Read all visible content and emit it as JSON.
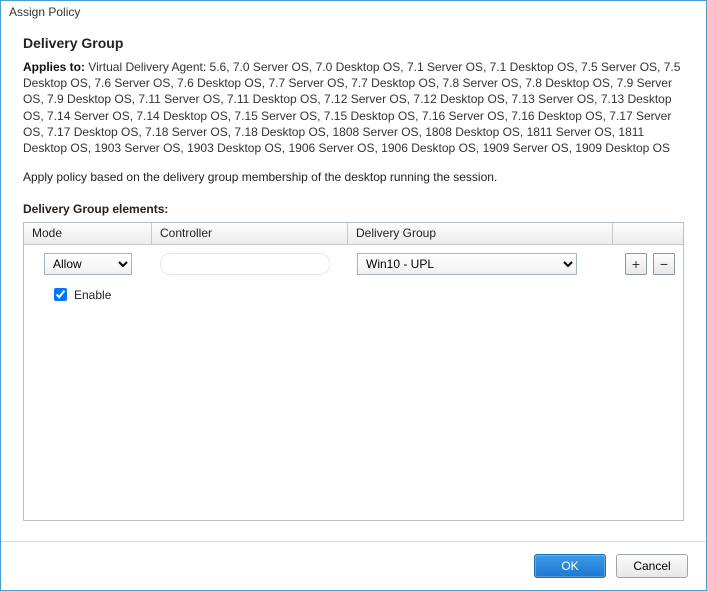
{
  "window_title": "Assign Policy",
  "heading": "Delivery Group",
  "applies_label": "Applies to:",
  "applies_text": "Virtual Delivery Agent: 5.6, 7.0 Server OS, 7.0 Desktop OS, 7.1 Server OS, 7.1 Desktop OS, 7.5 Server OS, 7.5 Desktop OS, 7.6 Server OS, 7.6 Desktop OS, 7.7 Server OS, 7.7 Desktop OS, 7.8 Server OS, 7.8 Desktop OS, 7.9 Server OS, 7.9 Desktop OS, 7.11 Server OS, 7.11 Desktop OS, 7.12 Server OS, 7.12 Desktop OS, 7.13 Server OS, 7.13 Desktop OS, 7.14 Server OS, 7.14 Desktop OS, 7.15 Server OS, 7.15 Desktop OS, 7.16 Server OS, 7.16 Desktop OS, 7.17 Server OS, 7.17 Desktop OS, 7.18 Server OS, 7.18 Desktop OS, 1808 Server OS, 1808 Desktop OS, 1811 Server OS, 1811 Desktop OS, 1903 Server OS, 1903 Desktop OS, 1906 Server OS, 1906 Desktop OS, 1909 Server OS, 1909 Desktop OS",
  "description": "Apply policy based on the delivery group membership of the desktop running the session.",
  "elements_heading": "Delivery Group elements:",
  "columns": {
    "mode": "Mode",
    "controller": "Controller",
    "delivery_group": "Delivery Group"
  },
  "row": {
    "mode_value": "Allow",
    "controller_value": "",
    "delivery_group_value": "Win10 - UPL"
  },
  "enable": {
    "label": "Enable",
    "checked": true
  },
  "buttons": {
    "add": "+",
    "remove": "−",
    "ok": "OK",
    "cancel": "Cancel"
  }
}
